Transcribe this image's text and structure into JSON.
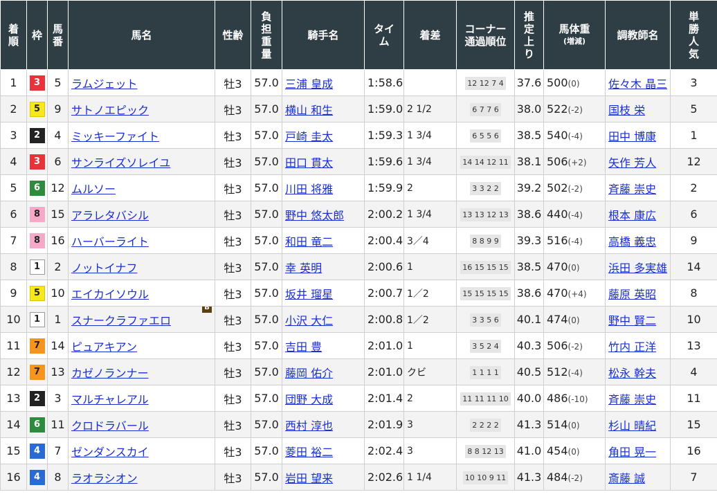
{
  "headers": {
    "rank": "着順",
    "waku": "枠",
    "umaban": "馬番",
    "horse": "馬名",
    "sexage": "性齢",
    "weight": "負担重量",
    "jockey": "騎手名",
    "time": "タイム",
    "margin": "着差",
    "corner_top": "コーナー",
    "corner_bottom": "通過順位",
    "last3f": "推定上り",
    "bodyweight_top": "馬体重",
    "bodyweight_bottom": "(増減)",
    "trainer": "調教師名",
    "popularity": "単勝人気"
  },
  "waku_colors": {
    "1": {
      "bg": "#ffffff",
      "fg": "#222222",
      "border": "#999999"
    },
    "2": {
      "bg": "#222222",
      "fg": "#ffffff",
      "border": "#222222"
    },
    "3": {
      "bg": "#e8333a",
      "fg": "#ffffff",
      "border": "#e8333a"
    },
    "4": {
      "bg": "#2a6ad6",
      "fg": "#ffffff",
      "border": "#2a6ad6"
    },
    "5": {
      "bg": "#f7e81a",
      "fg": "#222222",
      "border": "#d8c600"
    },
    "6": {
      "bg": "#2e8b3d",
      "fg": "#ffffff",
      "border": "#2e8b3d"
    },
    "7": {
      "bg": "#f7941d",
      "fg": "#222222",
      "border": "#f7941d"
    },
    "8": {
      "bg": "#f6a8c8",
      "fg": "#222222",
      "border": "#f6a8c8"
    }
  },
  "rows": [
    {
      "rank": "1",
      "waku": "3",
      "umaban": "5",
      "horse": "ラムジェット",
      "blinker": "",
      "sexage": "牡3",
      "weight": "57.0",
      "jockey": "三浦 皇成",
      "time": "1:58.6",
      "margin": "",
      "corner": "12 12 7 4",
      "last3f": "37.6",
      "bw": "500",
      "bwdiff": "(0)",
      "trainer": "佐々木 晶三",
      "pop": "3"
    },
    {
      "rank": "2",
      "waku": "5",
      "umaban": "9",
      "horse": "サトノエピック",
      "blinker": "",
      "sexage": "牡3",
      "weight": "57.0",
      "jockey": "横山 和生",
      "time": "1:59.0",
      "margin": "2 1/2",
      "corner": "6 7 7 6",
      "last3f": "38.0",
      "bw": "522",
      "bwdiff": "(-2)",
      "trainer": "国枝 栄",
      "pop": "5"
    },
    {
      "rank": "3",
      "waku": "2",
      "umaban": "4",
      "horse": "ミッキーファイト",
      "blinker": "",
      "sexage": "牡3",
      "weight": "57.0",
      "jockey": "戸崎 圭太",
      "time": "1:59.3",
      "margin": "1 3/4",
      "corner": "6 5 5 6",
      "last3f": "38.5",
      "bw": "540",
      "bwdiff": "(-4)",
      "trainer": "田中 博康",
      "pop": "1"
    },
    {
      "rank": "4",
      "waku": "3",
      "umaban": "6",
      "horse": "サンライズソレイユ",
      "blinker": "",
      "sexage": "牡3",
      "weight": "57.0",
      "jockey": "田口 貫太",
      "time": "1:59.6",
      "margin": "1 3/4",
      "corner": "14 14 12 11",
      "last3f": "38.1",
      "bw": "506",
      "bwdiff": "(+2)",
      "trainer": "矢作 芳人",
      "pop": "12"
    },
    {
      "rank": "5",
      "waku": "6",
      "umaban": "12",
      "horse": "ムルソー",
      "blinker": "",
      "sexage": "牡3",
      "weight": "57.0",
      "jockey": "川田 将雅",
      "time": "1:59.9",
      "margin": "2",
      "corner": "3 3 2 2",
      "last3f": "39.2",
      "bw": "502",
      "bwdiff": "(-2)",
      "trainer": "斉藤 崇史",
      "pop": "2"
    },
    {
      "rank": "6",
      "waku": "8",
      "umaban": "15",
      "horse": "アラレタバシル",
      "blinker": "",
      "sexage": "牡3",
      "weight": "57.0",
      "jockey": "野中 悠太郎",
      "time": "2:00.2",
      "margin": "1 3/4",
      "corner": "13 13 12 13",
      "last3f": "38.6",
      "bw": "440",
      "bwdiff": "(-4)",
      "trainer": "根本 康広",
      "pop": "6"
    },
    {
      "rank": "7",
      "waku": "8",
      "umaban": "16",
      "horse": "ハーバーライト",
      "blinker": "",
      "sexage": "牡3",
      "weight": "57.0",
      "jockey": "和田 竜二",
      "time": "2:00.4",
      "margin": "3／4",
      "corner": "8 8 9 9",
      "last3f": "39.3",
      "bw": "516",
      "bwdiff": "(-4)",
      "trainer": "高橋 義忠",
      "pop": "9"
    },
    {
      "rank": "8",
      "waku": "1",
      "umaban": "2",
      "horse": "ノットイナフ",
      "blinker": "",
      "sexage": "牡3",
      "weight": "57.0",
      "jockey": "幸 英明",
      "time": "2:00.6",
      "margin": "1",
      "corner": "16 15 15 15",
      "last3f": "38.5",
      "bw": "470",
      "bwdiff": "(0)",
      "trainer": "浜田 多実雄",
      "pop": "14"
    },
    {
      "rank": "9",
      "waku": "5",
      "umaban": "10",
      "horse": "エイカイソウル",
      "blinker": "",
      "sexage": "牡3",
      "weight": "57.0",
      "jockey": "坂井 瑠星",
      "time": "2:00.7",
      "margin": "1／2",
      "corner": "15 15 15 15",
      "last3f": "38.6",
      "bw": "470",
      "bwdiff": "(+4)",
      "trainer": "藤原 英昭",
      "pop": "8"
    },
    {
      "rank": "10",
      "waku": "1",
      "umaban": "1",
      "horse": "スナークラファエロ",
      "blinker": "B",
      "sexage": "牡3",
      "weight": "57.0",
      "jockey": "小沢 大仁",
      "time": "2:00.8",
      "margin": "1／2",
      "corner": "3 3 5 6",
      "last3f": "40.1",
      "bw": "474",
      "bwdiff": "(0)",
      "trainer": "野中 賢二",
      "pop": "10"
    },
    {
      "rank": "11",
      "waku": "7",
      "umaban": "14",
      "horse": "ピュアキアン",
      "blinker": "",
      "sexage": "牡3",
      "weight": "57.0",
      "jockey": "吉田 豊",
      "time": "2:01.0",
      "margin": "1",
      "corner": "3 5 2 4",
      "last3f": "40.3",
      "bw": "506",
      "bwdiff": "(-2)",
      "trainer": "竹内 正洋",
      "pop": "13"
    },
    {
      "rank": "12",
      "waku": "7",
      "umaban": "13",
      "horse": "カゼノランナー",
      "blinker": "",
      "sexage": "牡3",
      "weight": "57.0",
      "jockey": "藤岡 佑介",
      "time": "2:01.0",
      "margin": "クビ",
      "corner": "1 1 1 1",
      "last3f": "40.5",
      "bw": "512",
      "bwdiff": "(-4)",
      "trainer": "松永 幹夫",
      "pop": "4"
    },
    {
      "rank": "13",
      "waku": "2",
      "umaban": "3",
      "horse": "マルチャレアル",
      "blinker": "",
      "sexage": "牡3",
      "weight": "57.0",
      "jockey": "団野 大成",
      "time": "2:01.4",
      "margin": "2",
      "corner": "11 11 11 10",
      "last3f": "40.0",
      "bw": "486",
      "bwdiff": "(-10)",
      "trainer": "斉藤 崇史",
      "pop": "11"
    },
    {
      "rank": "14",
      "waku": "6",
      "umaban": "11",
      "horse": "クロドラバール",
      "blinker": "",
      "sexage": "牡3",
      "weight": "57.0",
      "jockey": "西村 淳也",
      "time": "2:01.9",
      "margin": "3",
      "corner": "2 2 2 2",
      "last3f": "41.3",
      "bw": "514",
      "bwdiff": "(0)",
      "trainer": "杉山 晴紀",
      "pop": "15"
    },
    {
      "rank": "15",
      "waku": "4",
      "umaban": "7",
      "horse": "ゼンダンスカイ",
      "blinker": "",
      "sexage": "牡3",
      "weight": "57.0",
      "jockey": "菱田 裕二",
      "time": "2:02.4",
      "margin": "3",
      "corner": "8 8 12 13",
      "last3f": "41.0",
      "bw": "454",
      "bwdiff": "(0)",
      "trainer": "角田 晃一",
      "pop": "16"
    },
    {
      "rank": "16",
      "waku": "4",
      "umaban": "8",
      "horse": "ラオラシオン",
      "blinker": "",
      "sexage": "牡3",
      "weight": "57.0",
      "jockey": "岩田 望来",
      "time": "2:02.6",
      "margin": "1 1/4",
      "corner": "10 10 9 11",
      "last3f": "41.3",
      "bw": "484",
      "bwdiff": "(-2)",
      "trainer": "斎藤 誠",
      "pop": "7"
    }
  ]
}
